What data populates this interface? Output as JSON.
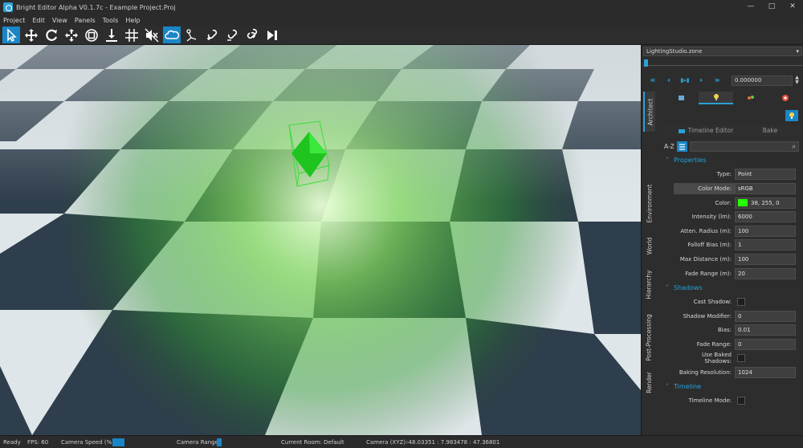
{
  "window": {
    "title": "Bright Editor Alpha V0.1.7c - Example Project.Proj",
    "controls": [
      "—",
      "□",
      "✕"
    ]
  },
  "menu": [
    "Project",
    "Edit",
    "View",
    "Panels",
    "Tools",
    "Help"
  ],
  "toolbar": [
    {
      "name": "select-tool-icon",
      "active": true
    },
    {
      "name": "move-tool-icon",
      "active": false
    },
    {
      "name": "rotate-tool-icon",
      "active": false
    },
    {
      "name": "scale-tool-icon",
      "active": false
    },
    {
      "name": "target-tool-icon",
      "active": false
    },
    {
      "name": "drop-to-floor-icon",
      "active": false
    },
    {
      "name": "grid-snap-icon",
      "active": false
    },
    {
      "name": "mute-audio-icon",
      "active": false
    },
    {
      "name": "cloud-icon",
      "active": true
    },
    {
      "name": "pen-path-icon",
      "active": false
    },
    {
      "name": "link-add-icon",
      "active": false
    },
    {
      "name": "link-edit-icon",
      "active": false
    },
    {
      "name": "link-icon",
      "active": false
    },
    {
      "name": "play-step-icon",
      "active": false
    }
  ],
  "panel": {
    "zone": "LightingStudio.zone",
    "playback": [
      "«",
      "‹",
      "▮▸▮",
      "›",
      "»"
    ],
    "time": "0.000000",
    "vertical_tabs": [
      "Architect",
      "Environment",
      "World",
      "Hierarchy",
      "Post-Processing",
      "Render"
    ],
    "sub_tabs": [
      "Timeline Editor",
      "Bake"
    ],
    "sort_label": "A-Z",
    "properties_title": "Properties",
    "properties": [
      {
        "label": "Type:",
        "value": "Point"
      },
      {
        "label": "Color Mode:",
        "value": "sRGB"
      },
      {
        "label": "Color:",
        "value": "38, 255, 0"
      },
      {
        "label": "Intensity (lm):",
        "value": "6000"
      },
      {
        "label": "Atten. Radius (m):",
        "value": "100"
      },
      {
        "label": "Falloff Bias (m):",
        "value": "1"
      },
      {
        "label": "Max Distance (m):",
        "value": "100"
      },
      {
        "label": "Fade Range (m):",
        "value": "20"
      }
    ],
    "shadows_title": "Shadows",
    "shadows": [
      {
        "label": "Cast Shadow:",
        "value": ""
      },
      {
        "label": "Shadow Modifier:",
        "value": "0"
      },
      {
        "label": "Bias:",
        "value": "0.01"
      },
      {
        "label": "Fade Range:",
        "value": "0"
      },
      {
        "label": "Use Baked Shadows:",
        "value": ""
      },
      {
        "label": "Baking Resolution:",
        "value": "1024"
      }
    ],
    "timeline_title": "Timeline",
    "timeline": [
      {
        "label": "Timeline Mode:",
        "value": ""
      }
    ],
    "light_color": "#26ff00",
    "accent": "#2aa1d6"
  },
  "status": {
    "state": "Ready",
    "fps": "FPS: 60",
    "camera_speed": "Camera  Speed (%):",
    "camera_range": "Camera Range:",
    "room": "Current Room: Default",
    "coords_label": "Camera (XYZ):",
    "coords": "-48.03351 : 7.983478 : 47.36801"
  }
}
